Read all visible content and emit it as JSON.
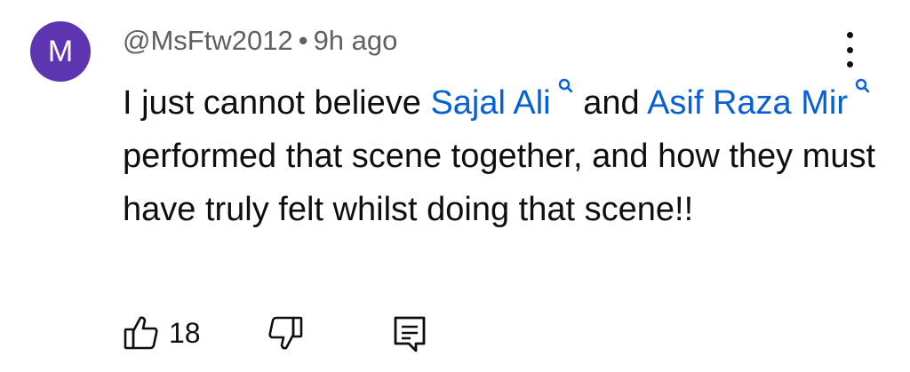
{
  "comment": {
    "avatar_letter": "M",
    "author": "@MsFtw2012",
    "separator": "•",
    "time": "9h ago",
    "text_part1": "I just cannot believe ",
    "link1": "Sajal Ali",
    "text_part2": " and ",
    "link2": "Asif Raza Mir",
    "text_part3": " performed that scene together, and how they must have truly felt whilst doing that scene!!",
    "like_count": "18",
    "icons": [
      "more-vert-icon",
      "search-icon",
      "thumbs-up-icon",
      "thumbs-down-icon",
      "reply-icon"
    ],
    "colors": {
      "link": "#065fd4",
      "avatar": "#5e35b1",
      "meta": "#606060"
    }
  }
}
